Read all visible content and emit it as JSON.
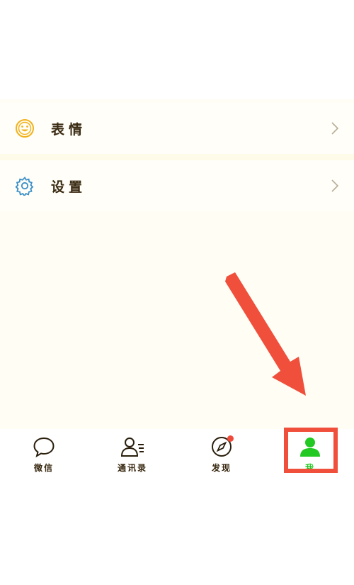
{
  "menu": {
    "items": [
      {
        "label": "表情",
        "icon": "smiley-icon",
        "icon_color": "#f2b21c"
      },
      {
        "label": "设置",
        "icon": "gear-icon",
        "icon_color": "#3a8fc7"
      }
    ]
  },
  "tabbar": {
    "tabs": [
      {
        "label": "微信",
        "icon": "chat-bubble-icon",
        "active": false
      },
      {
        "label": "通讯录",
        "icon": "contacts-icon",
        "active": false
      },
      {
        "label": "发现",
        "icon": "compass-icon",
        "active": false,
        "badge": true
      },
      {
        "label": "我",
        "icon": "person-icon",
        "active": true
      }
    ]
  },
  "colors": {
    "active": "#22c922",
    "annotation": "#f04f3c",
    "text": "#3a2a12",
    "badge": "#f04a3a"
  },
  "annotation": {
    "arrow": "arrow-pointing-to-me-tab",
    "highlight": "me-tab"
  }
}
